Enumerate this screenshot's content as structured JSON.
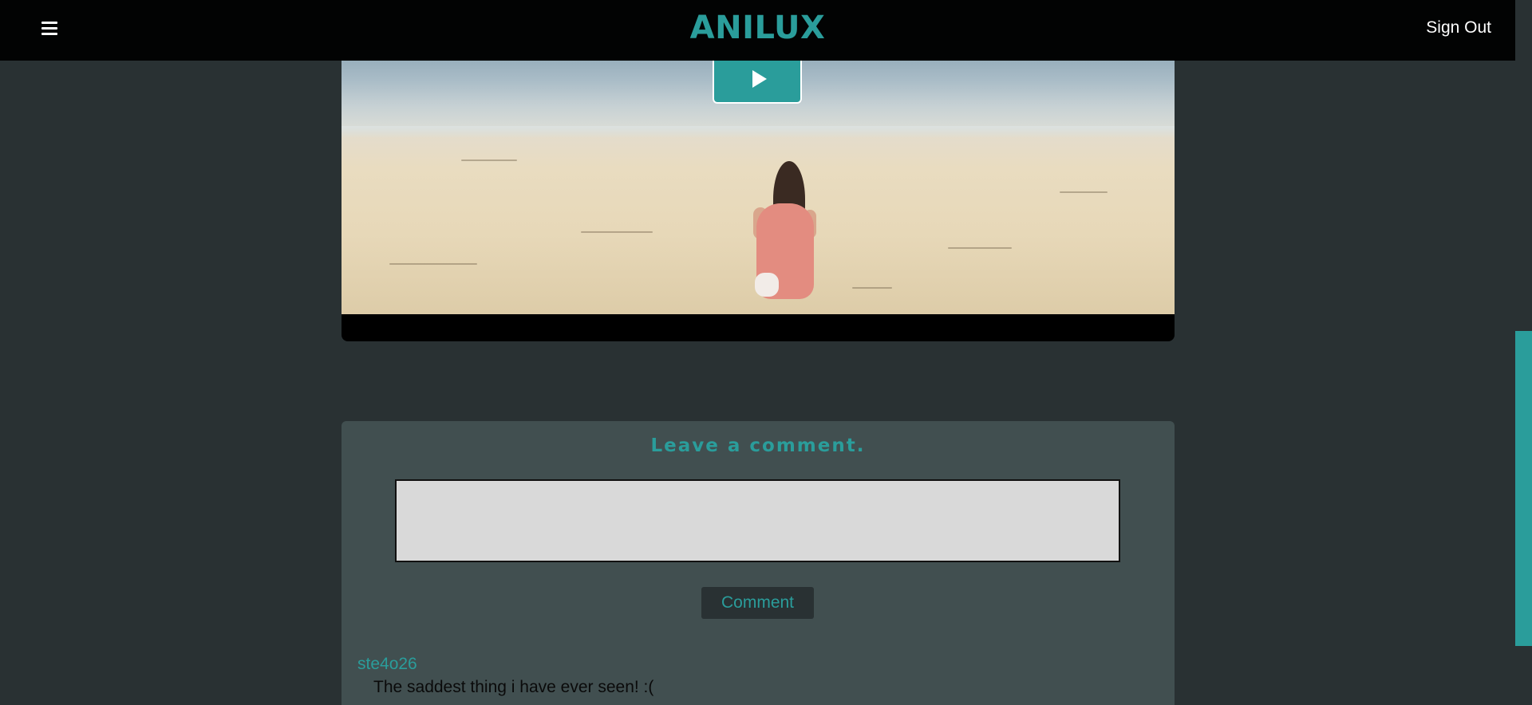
{
  "header": {
    "logo": "ANILUX",
    "menu_icon": "hamburger-menu-icon",
    "sign_out_label": "Sign Out"
  },
  "video": {
    "play_icon": "play-icon"
  },
  "comments": {
    "title": "Leave a comment.",
    "input_value": "",
    "submit_label": "Comment",
    "items": [
      {
        "user": "ste4o26",
        "text": "The saddest thing i have ever seen! :("
      }
    ]
  },
  "colors": {
    "accent": "#2a9d9b",
    "background": "#293133",
    "header": "#020303",
    "card": "#414f50",
    "input": "#d9d9d9"
  }
}
